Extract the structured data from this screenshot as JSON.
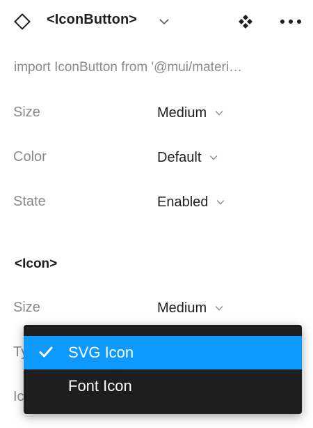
{
  "header": {
    "title": "<IconButton>",
    "icons": [
      "component-instance-icon",
      "chevron-down-icon",
      "variants-icon",
      "more-icon"
    ]
  },
  "import_line": "import IconButton from '@mui/materi…",
  "props": [
    {
      "label": "Size",
      "value": "Medium"
    },
    {
      "label": "Color",
      "value": "Default"
    },
    {
      "label": "State",
      "value": "Enabled"
    }
  ],
  "icon_section": {
    "title": "<Icon>",
    "props": [
      {
        "label": "Size",
        "value": "Medium"
      },
      {
        "label": "Ty",
        "value": ""
      },
      {
        "label": "Ic",
        "value": ""
      }
    ]
  },
  "dropdown": {
    "options": [
      {
        "label": "SVG Icon",
        "selected": true
      },
      {
        "label": "Font Icon",
        "selected": false
      }
    ]
  },
  "colors": {
    "accent": "#0d99ff",
    "menu_bg": "#1e1e1e",
    "label_gray": "#8a8a8a",
    "text_dark": "#1e1e1e"
  }
}
